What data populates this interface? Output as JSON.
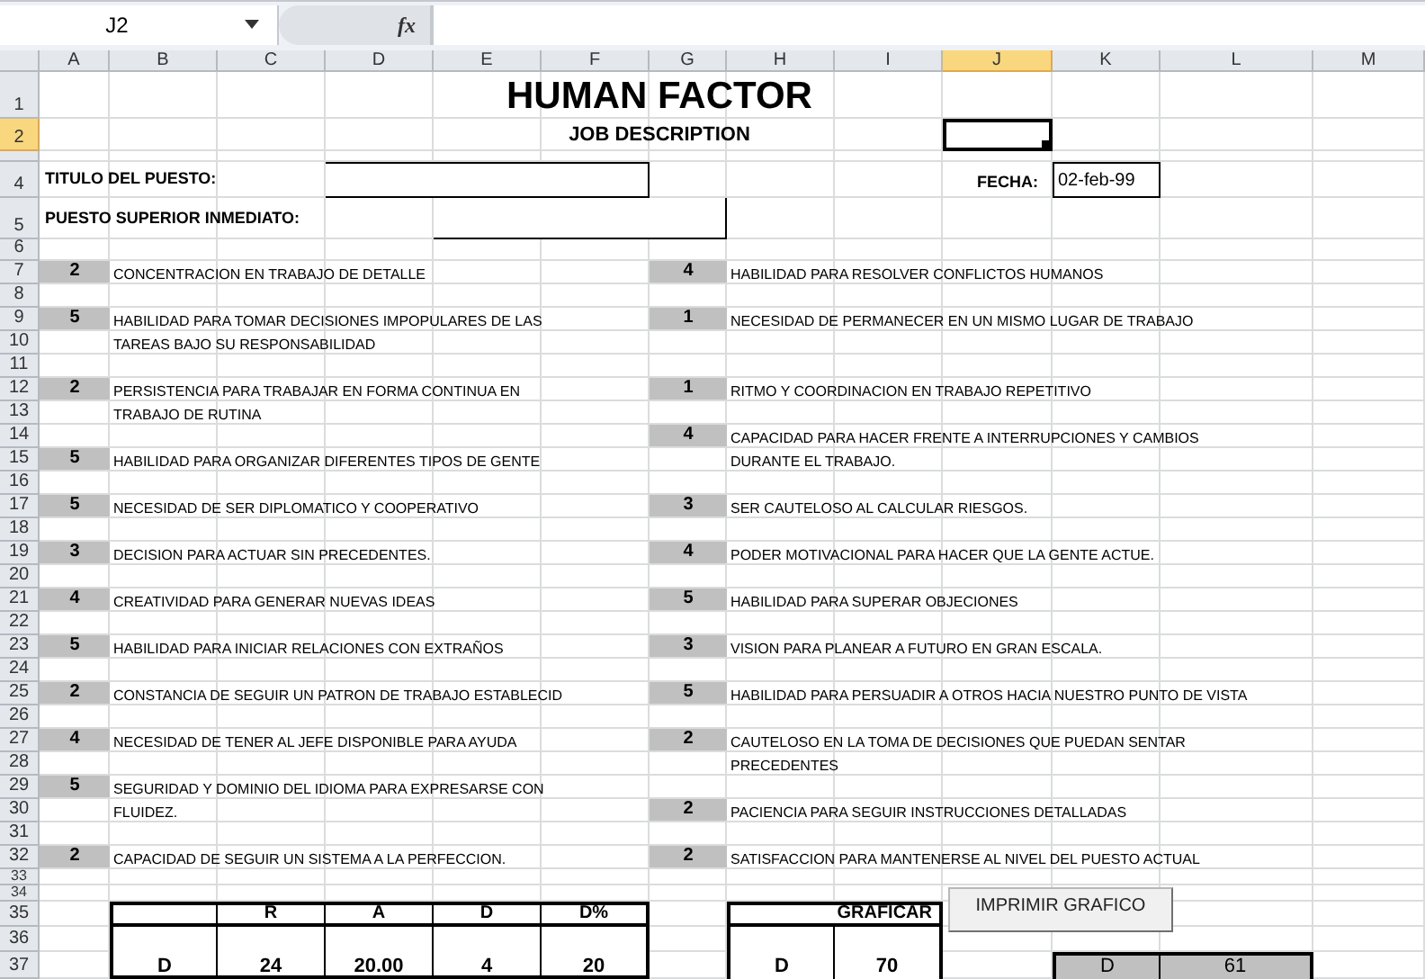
{
  "formula_bar": {
    "name_box": "J2",
    "function_label": "fx"
  },
  "columns": [
    {
      "label": "A",
      "selected": false
    },
    {
      "label": "B",
      "selected": false
    },
    {
      "label": "C",
      "selected": false
    },
    {
      "label": "D",
      "selected": false
    },
    {
      "label": "E",
      "selected": false
    },
    {
      "label": "F",
      "selected": false
    },
    {
      "label": "G",
      "selected": false
    },
    {
      "label": "H",
      "selected": false
    },
    {
      "label": "I",
      "selected": false
    },
    {
      "label": "J",
      "selected": true
    },
    {
      "label": "K",
      "selected": false
    },
    {
      "label": "L",
      "selected": false
    },
    {
      "label": "M",
      "selected": false
    }
  ],
  "rows": [
    {
      "label": "1",
      "selected": false
    },
    {
      "label": "2",
      "selected": true
    },
    {
      "selected": false
    },
    {
      "label": "4",
      "selected": false
    },
    {
      "label": "5",
      "selected": false
    },
    {
      "label": "6",
      "selected": false
    },
    {
      "label": "7",
      "selected": false
    },
    {
      "label": "8",
      "selected": false
    },
    {
      "label": "9",
      "selected": false
    },
    {
      "label": "10",
      "selected": false
    },
    {
      "label": "11",
      "selected": false
    },
    {
      "label": "12",
      "selected": false
    },
    {
      "label": "13",
      "selected": false
    },
    {
      "label": "14",
      "selected": false
    },
    {
      "label": "15",
      "selected": false
    },
    {
      "label": "16",
      "selected": false
    },
    {
      "label": "17",
      "selected": false
    },
    {
      "label": "18",
      "selected": false
    },
    {
      "label": "19",
      "selected": false
    },
    {
      "label": "20",
      "selected": false
    },
    {
      "label": "21",
      "selected": false
    },
    {
      "label": "22",
      "selected": false
    },
    {
      "label": "23",
      "selected": false
    },
    {
      "label": "24",
      "selected": false
    },
    {
      "label": "25",
      "selected": false
    },
    {
      "label": "26",
      "selected": false
    },
    {
      "label": "27",
      "selected": false
    },
    {
      "label": "28",
      "selected": false
    },
    {
      "label": "29",
      "selected": false
    },
    {
      "label": "30",
      "selected": false
    },
    {
      "label": "31",
      "selected": false
    },
    {
      "label": "32",
      "selected": false
    },
    {
      "label": "33",
      "selected": false
    },
    {
      "label": "34",
      "selected": false
    },
    {
      "label": "35",
      "selected": false
    },
    {
      "label": "36",
      "selected": false
    },
    {
      "label": "37",
      "selected": false
    }
  ],
  "title": "HUMAN FACTOR",
  "subtitle": "JOB DESCRIPTION",
  "job_title_label": "TITULO DEL PUESTO:",
  "supervisor_label": "PUESTO SUPERIOR INMEDIATO:",
  "date_label": "FECHA:",
  "date_value": "02-feb-99",
  "left_traits": [
    {
      "score": "2",
      "lines": [
        "CONCENTRACION EN TRABAJO DE DETALLE"
      ]
    },
    {
      "score": "5",
      "lines": [
        "HABILIDAD PARA TOMAR DECISIONES IMPOPULARES DE LAS",
        "TAREAS BAJO SU RESPONSABILIDAD"
      ]
    },
    {
      "score": "2",
      "lines": [
        "PERSISTENCIA PARA TRABAJAR EN FORMA CONTINUA EN",
        "TRABAJO DE RUTINA"
      ]
    },
    {
      "score": "5",
      "lines": [
        "HABILIDAD PARA ORGANIZAR DIFERENTES TIPOS DE GENTE"
      ]
    },
    {
      "score": "5",
      "lines": [
        "NECESIDAD DE SER DIPLOMATICO Y COOPERATIVO"
      ]
    },
    {
      "score": "3",
      "lines": [
        "DECISION PARA ACTUAR SIN PRECEDENTES."
      ]
    },
    {
      "score": "4",
      "lines": [
        "CREATIVIDAD PARA GENERAR NUEVAS IDEAS"
      ]
    },
    {
      "score": "5",
      "lines": [
        "HABILIDAD PARA INICIAR RELACIONES CON EXTRAÑOS"
      ]
    },
    {
      "score": "2",
      "lines": [
        "CONSTANCIA DE SEGUIR UN PATRON DE TRABAJO ESTABLECID"
      ]
    },
    {
      "score": "4",
      "lines": [
        "NECESIDAD DE TENER AL JEFE DISPONIBLE PARA AYUDA"
      ]
    },
    {
      "score": "5",
      "lines": [
        "SEGURIDAD Y DOMINIO DEL IDIOMA PARA EXPRESARSE CON",
        "FLUIDEZ."
      ]
    },
    {
      "score": "2",
      "lines": [
        "CAPACIDAD DE SEGUIR UN SISTEMA A LA PERFECCION."
      ]
    }
  ],
  "right_traits": [
    {
      "score": "4",
      "lines": [
        "HABILIDAD PARA RESOLVER CONFLICTOS HUMANOS"
      ]
    },
    {
      "score": "1",
      "lines": [
        "NECESIDAD DE PERMANECER EN UN MISMO LUGAR DE TRABAJO"
      ]
    },
    {
      "score": "1",
      "lines": [
        "RITMO Y COORDINACION EN TRABAJO REPETITIVO"
      ]
    },
    {
      "score": "4",
      "lines": [
        "CAPACIDAD PARA HACER FRENTE A INTERRUPCIONES Y CAMBIOS",
        "DURANTE EL TRABAJO."
      ]
    },
    {
      "score": "3",
      "lines": [
        "SER CAUTELOSO AL CALCULAR RIESGOS."
      ]
    },
    {
      "score": "4",
      "lines": [
        "PODER MOTIVACIONAL PARA HACER QUE LA GENTE ACTUE."
      ]
    },
    {
      "score": "5",
      "lines": [
        "HABILIDAD PARA SUPERAR OBJECIONES"
      ]
    },
    {
      "score": "3",
      "lines": [
        "VISION PARA PLANEAR A FUTURO EN GRAN ESCALA."
      ]
    },
    {
      "score": "5",
      "lines": [
        "HABILIDAD PARA PERSUADIR A OTROS HACIA NUESTRO PUNTO DE VISTA"
      ]
    },
    {
      "score": "2",
      "lines": [
        "CAUTELOSO EN LA TOMA DE DECISIONES QUE PUEDAN SENTAR",
        "PRECEDENTES"
      ]
    },
    {
      "score": "2",
      "lines": [
        "PACIENCIA PARA SEGUIR INSTRUCCIONES DETALLADAS"
      ]
    },
    {
      "score": "2",
      "lines": [
        "SATISFACCION PARA MANTENERSE AL NIVEL DEL PUESTO ACTUAL"
      ]
    }
  ],
  "summary_table": {
    "columns": [
      "R",
      "A",
      "D",
      "D%"
    ],
    "rows": [
      {
        "label": "D",
        "values": [
          "24",
          "20.00",
          "4",
          "20"
        ]
      }
    ]
  },
  "graph_table": {
    "header": "GRAFICAR",
    "label": "D",
    "value": "70"
  },
  "print_button": "IMPRIMIR GRAFICO",
  "result": {
    "label": "D",
    "value": "61"
  }
}
